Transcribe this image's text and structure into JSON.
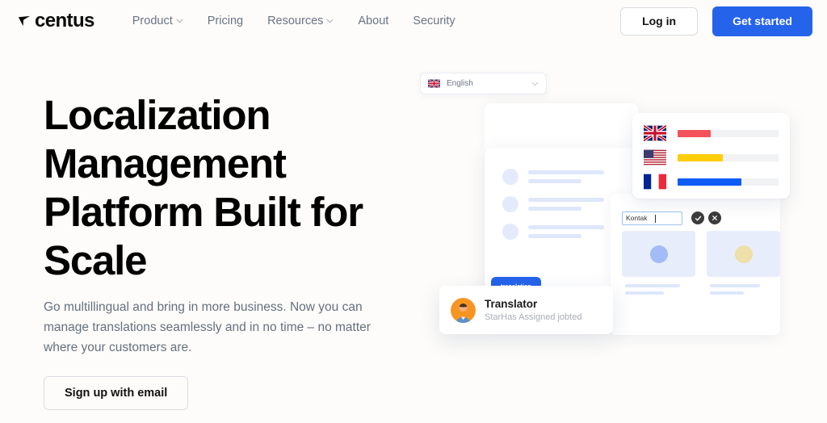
{
  "brand": {
    "name": "centus",
    "logo_icon": "cursor-arrow-icon",
    "accent_color": "#2563EB"
  },
  "header": {
    "nav": [
      {
        "label": "Product",
        "has_dropdown": true,
        "name": "product"
      },
      {
        "label": "Pricing",
        "has_dropdown": false,
        "name": "pricing"
      },
      {
        "label": "Resources",
        "has_dropdown": true,
        "name": "resources"
      },
      {
        "label": "About",
        "has_dropdown": false,
        "name": "about"
      },
      {
        "label": "Security",
        "has_dropdown": false,
        "name": "security"
      }
    ],
    "login_label": "Log in",
    "get_started_label": "Get started"
  },
  "hero": {
    "title": "Localization Management Platform Built for Scale",
    "subtitle": "Go multillingual and bring in more business. Now you can manage translations seamlessly and in no time – no matter where your customers are.",
    "cta_label": "Sign up with email"
  },
  "illustration": {
    "language_dropdown": {
      "flag": "uk-flag-icon",
      "value": "English",
      "chevron": "chevron-down-icon"
    },
    "list_cta_label": "translation",
    "progress_rows": [
      {
        "flag": "uk-flag-icon",
        "country": "United Kingdom",
        "percent": 33,
        "color": "#F4525B"
      },
      {
        "flag": "usa-flag-icon",
        "country": "United States",
        "percent": 45,
        "color": "#FFCE07"
      },
      {
        "flag": "france-flag-icon",
        "country": "France",
        "percent": 63,
        "color": "#0D5CF5"
      }
    ],
    "search_input": {
      "value": "Kontak",
      "confirm_icon": "check-circle-icon",
      "cancel_icon": "close-circle-icon"
    },
    "thumbnails": [
      {
        "dot_color": "#A3BCF7"
      },
      {
        "dot_color": "#EFDFA8"
      }
    ],
    "translator_card": {
      "avatar": "person-avatar",
      "title": "Translator",
      "subtitle": "StarHas Assigned jobted"
    }
  }
}
